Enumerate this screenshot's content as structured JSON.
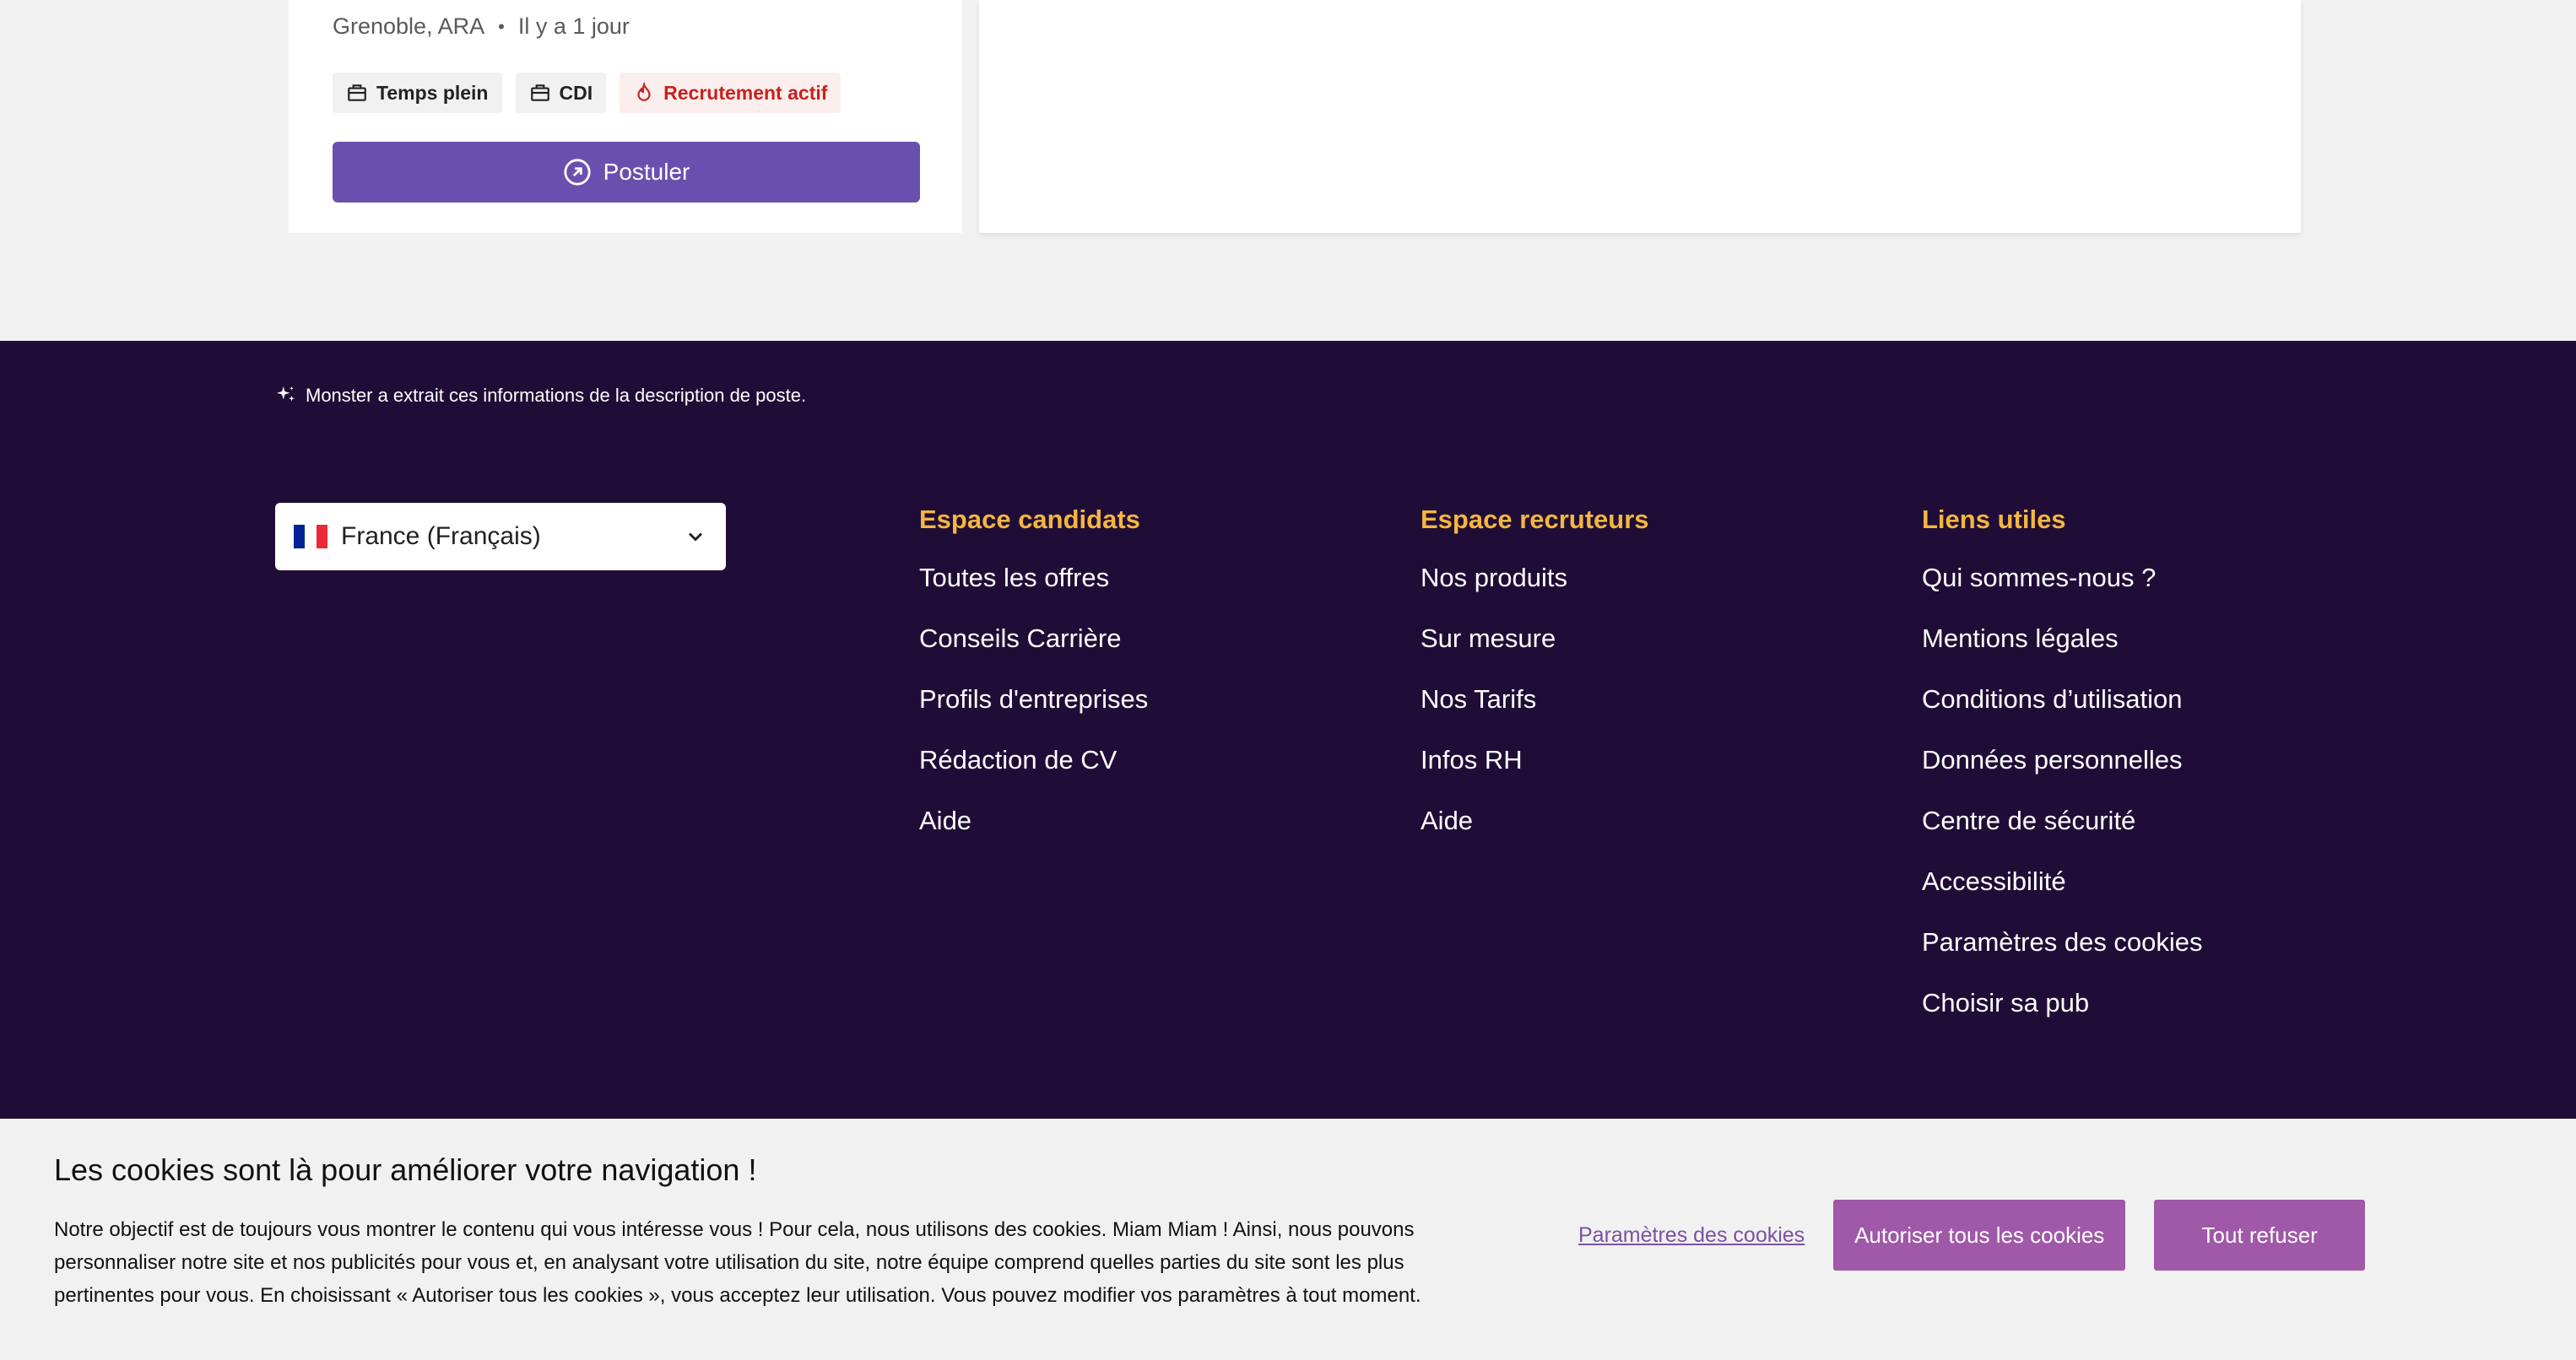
{
  "job_card": {
    "location": "Grenoble, ARA",
    "separator": "•",
    "posted": "Il y a 1 jour",
    "tags": [
      {
        "label": "Temps plein",
        "icon": "briefcase-icon"
      },
      {
        "label": "CDI",
        "icon": "briefcase-icon"
      },
      {
        "label": "Recrutement actif",
        "icon": "flame-icon"
      }
    ],
    "apply_label": "Postuler"
  },
  "footer": {
    "ai_note": "Monster a extrait ces informations de la description de poste.",
    "country_select": {
      "value": "France (Français)",
      "flag_colors": [
        "#002395",
        "#ffffff",
        "#ed2939"
      ]
    },
    "columns": [
      {
        "title": "Espace candidats",
        "links": [
          "Toutes les offres",
          "Conseils Carrière",
          "Profils d'entreprises",
          "Rédaction de CV",
          "Aide"
        ]
      },
      {
        "title": "Espace recruteurs",
        "links": [
          "Nos produits",
          "Sur mesure",
          "Nos Tarifs",
          "Infos RH",
          "Aide"
        ]
      },
      {
        "title": "Liens utiles",
        "links": [
          "Qui sommes-nous ?",
          "Mentions légales",
          "Conditions d’utilisation",
          "Données personnelles",
          "Centre de sécurité",
          "Accessibilité",
          "Paramètres des cookies",
          "Choisir sa pub"
        ]
      }
    ]
  },
  "cookie_banner": {
    "title": "Les cookies sont là pour améliorer votre navigation !",
    "body": "Notre objectif est de toujours vous montrer le contenu qui vous intéresse vous ! Pour cela, nous utilisons des cookies. Miam Miam ! Ainsi, nous pouvons personnaliser notre site et nos publicités pour vous et, en analysant votre utilisation du site, notre équipe comprend quelles parties du site sont les plus pertinentes pour vous. En choisissant « Autoriser tous les cookies », vous acceptez leur utilisation. Vous pouvez modifier vos paramètres à tout moment.",
    "settings_link": "Paramètres des cookies",
    "allow_label": "Autoriser tous les cookies",
    "refuse_label": "Tout refuser"
  },
  "colors": {
    "footer_bg": "#200d37",
    "footer_heading": "#f4b63f",
    "primary_button": "#6b4fae",
    "cookie_button": "#a058a8",
    "active_tag": "#c8211c"
  }
}
